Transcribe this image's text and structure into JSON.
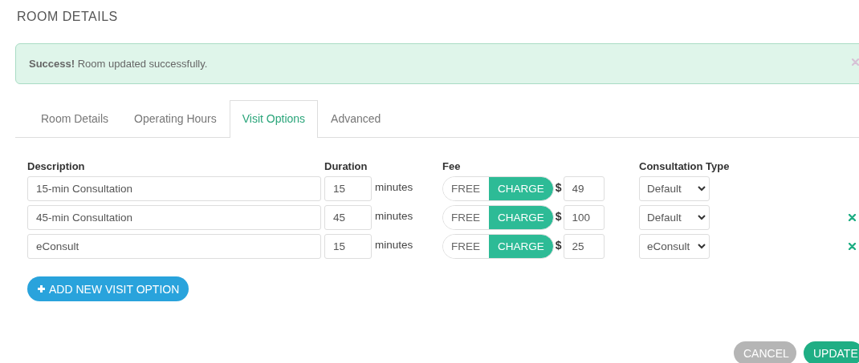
{
  "page_title": "ROOM DETAILS",
  "alert": {
    "message": "**Success!** Room updated successfully.",
    "dismissible": true
  },
  "tabs": [
    {
      "label": "Room Details",
      "selected": false
    },
    {
      "label": "Operating Hours",
      "selected": false
    },
    {
      "label": "Visit Options",
      "selected": true
    },
    {
      "label": "Advanced",
      "selected": false
    }
  ],
  "columns": [
    "Description",
    "Duration",
    "Fee",
    "Consultation Type"
  ],
  "visit_options": [
    {
      "description": "15-min Consultation",
      "duration": "15",
      "unit": "minutes",
      "fee_modes": [
        {
          "label": "FREE",
          "selected": false
        },
        {
          "label": "CHARGE",
          "selected": true
        }
      ],
      "currency": "$",
      "fee": "49",
      "consultation_type": "Default",
      "removable": false
    },
    {
      "description": "45-min Consultation",
      "duration": "45",
      "unit": "minutes",
      "fee_modes": [
        {
          "label": "FREE",
          "selected": false
        },
        {
          "label": "CHARGE",
          "selected": true
        }
      ],
      "currency": "$",
      "fee": "100",
      "consultation_type": "Default",
      "removable": true
    },
    {
      "description": "eConsult",
      "duration": "15",
      "unit": "minutes",
      "fee_modes": [
        {
          "label": "FREE",
          "selected": false
        },
        {
          "label": "CHARGE",
          "selected": true
        }
      ],
      "currency": "$",
      "fee": "25",
      "consultation_type": "eConsult",
      "removable": true
    }
  ],
  "add_button": "ADD NEW VISIT OPTION",
  "actions": [
    "CANCEL",
    "UPDATE"
  ]
}
